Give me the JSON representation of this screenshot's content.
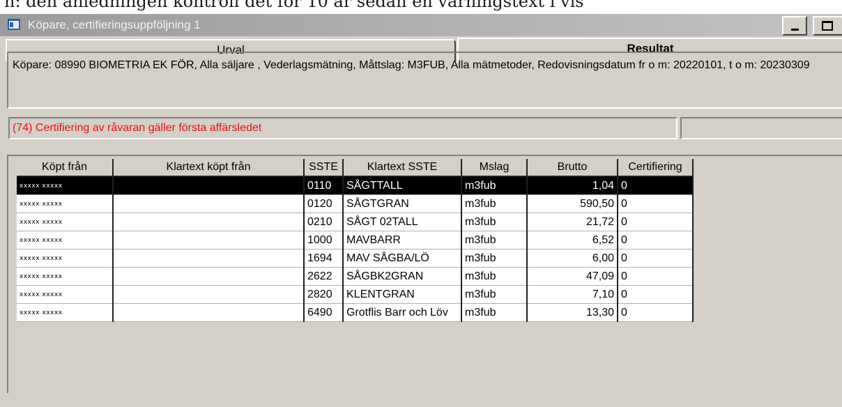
{
  "document_line": "n: den anledningen kontroll det för 10 år sedan en varningstext i vis",
  "window": {
    "title": "Köpare, certifieringsuppföljning 1"
  },
  "tabs": [
    {
      "label": "Urval"
    },
    {
      "label": "Resultat"
    }
  ],
  "description": "Köpare: 08990 BIOMETRIA EK FÖR, Alla säljare , Vederlagsmätning, Måttslag: M3FUB, Alla mätmetoder, Redovisningsdatum  fr o m: 20220101, t o m: 20230309",
  "status_message": "(74) Certifiering av råvaran gäller första affärsledet",
  "status_right": "",
  "table": {
    "columns": [
      "Köpt från",
      "Klartext köpt från",
      "SSTE",
      "Klartext SSTE",
      "Mslag",
      "Brutto",
      "Certifiering"
    ],
    "rows": [
      {
        "kopt_fran": "xxxxx xxxxx",
        "klartext_kopt": "",
        "sste": "0110",
        "klartext_sste": "SÅGTTALL",
        "mslag": "m3fub",
        "brutto": "1,04",
        "cert": "0"
      },
      {
        "kopt_fran": "xxxxx xxxxx",
        "klartext_kopt": "",
        "sste": "0120",
        "klartext_sste": "SÅGTGRAN",
        "mslag": "m3fub",
        "brutto": "590,50",
        "cert": "0"
      },
      {
        "kopt_fran": "xxxxx xxxxx",
        "klartext_kopt": "",
        "sste": "0210",
        "klartext_sste": "SÅGT 02TALL",
        "mslag": "m3fub",
        "brutto": "21,72",
        "cert": "0"
      },
      {
        "kopt_fran": "xxxxx xxxxx",
        "klartext_kopt": "",
        "sste": "1000",
        "klartext_sste": "MAVBARR",
        "mslag": "m3fub",
        "brutto": "6,52",
        "cert": "0"
      },
      {
        "kopt_fran": "xxxxx xxxxx",
        "klartext_kopt": "",
        "sste": "1694",
        "klartext_sste": "MAV SÅGBA/LÖ",
        "mslag": "m3fub",
        "brutto": "6,00",
        "cert": "0"
      },
      {
        "kopt_fran": "xxxxx xxxxx",
        "klartext_kopt": "",
        "sste": "2622",
        "klartext_sste": "SÅGBK2GRAN",
        "mslag": "m3fub",
        "brutto": "47,09",
        "cert": "0"
      },
      {
        "kopt_fran": "xxxxx xxxxx",
        "klartext_kopt": "",
        "sste": "2820",
        "klartext_sste": "KLENTGRAN",
        "mslag": "m3fub",
        "brutto": "7,10",
        "cert": "0"
      },
      {
        "kopt_fran": "xxxxx xxxxx",
        "klartext_kopt": "",
        "sste": "6490",
        "klartext_sste": "Grotflis Barr och Löv",
        "mslag": "m3fub",
        "brutto": "13,30",
        "cert": "0"
      }
    ]
  },
  "colors": {
    "selection": "#000000",
    "status_text": "#e81010",
    "window_face": "#d4d0c8"
  },
  "icons": [
    "app-window-icon",
    "minimize-icon",
    "maximize-icon"
  ]
}
